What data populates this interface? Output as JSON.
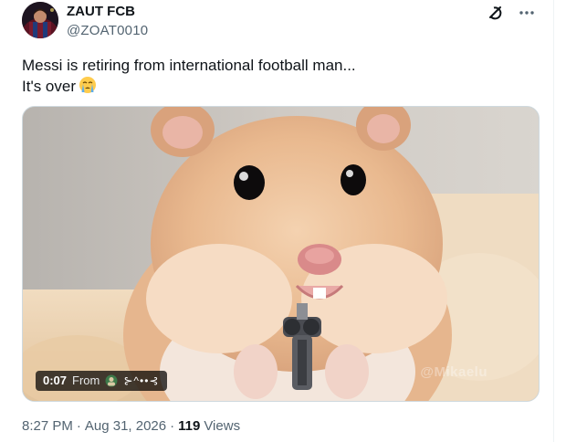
{
  "author": {
    "display_name": "ZAUT FCB",
    "handle": "@ZOAT0010",
    "avatar_icon": "avatar-image"
  },
  "actions": {
    "grok_icon": "grok-icon",
    "more_icon": "more-icon"
  },
  "tweet": {
    "line1": "Messi is retiring from international football man...",
    "line2": "It's over",
    "emoji": "loudly-crying-face-emoji"
  },
  "media": {
    "description_icon": "video-thumbnail",
    "duration": "0:07",
    "from_label": "From",
    "source_name": "⊱^••⊰",
    "watermark": "@Mikaelu"
  },
  "meta": {
    "time": "8:27 PM",
    "separator": "·",
    "date": "Aug 31, 2026",
    "separator2": "·",
    "views_count": "119",
    "views_label": "Views"
  },
  "colors": {
    "text_primary": "#0f1419",
    "text_secondary": "#536471",
    "border": "#cfd9de"
  }
}
